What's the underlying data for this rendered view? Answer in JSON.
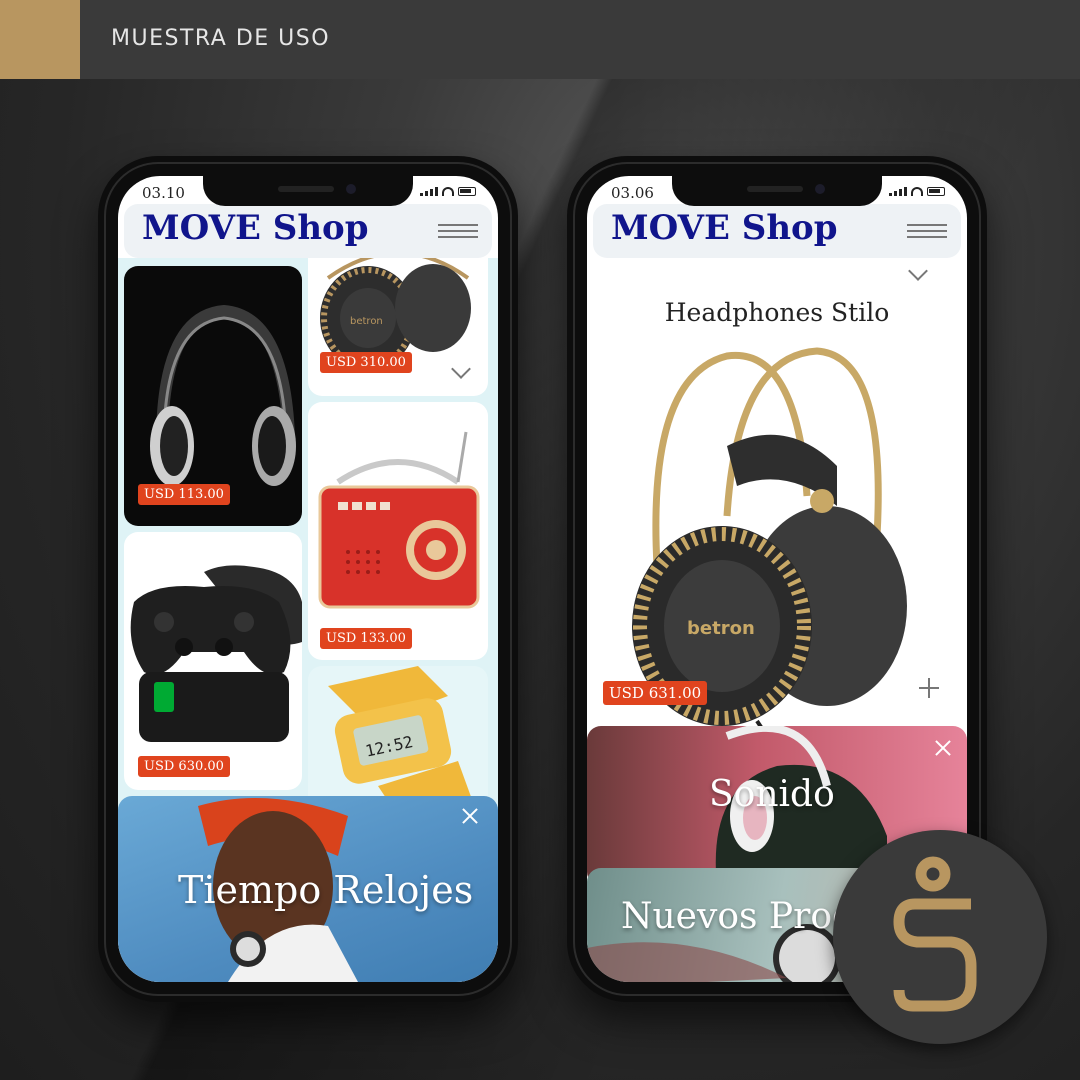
{
  "banner": {
    "title": "MUESTRA DE USO"
  },
  "phone_left": {
    "time": "03.10",
    "app_title": "MOVE Shop",
    "products": [
      {
        "price": "USD 310.00"
      },
      {
        "price": "USD 113.00"
      },
      {
        "price": "USD 133.00"
      },
      {
        "price": "USD 630.00"
      }
    ],
    "promo_title": "Tiempo Relojes"
  },
  "phone_right": {
    "time": "03.06",
    "app_title": "MOVE Shop",
    "product_name": "Headphones Stilo",
    "product_price": "USD 631.00",
    "category_1": "Sonido",
    "category_2": "Nuevos Prod"
  },
  "colors": {
    "brand_blue": "#10158c",
    "price_orange": "#e0441e",
    "gold": "#b89660"
  }
}
